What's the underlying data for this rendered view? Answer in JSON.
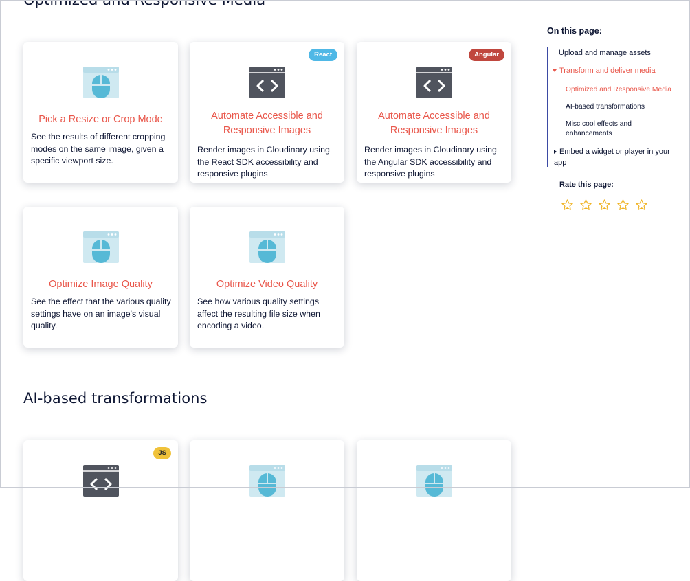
{
  "sections": [
    {
      "title": "Optimized and Responsive Media"
    },
    {
      "title": "AI-based transformations"
    }
  ],
  "cards": [
    {
      "title": "Pick a Resize or Crop Mode",
      "description": "See the results of different cropping modes on the same image, given a specific viewport size.",
      "icon": "mouse-window-icon",
      "badge": ""
    },
    {
      "title": "Automate Accessible and Responsive Images",
      "description": "Render images in Cloudinary using the React SDK accessibility and responsive plugins",
      "icon": "code-window-icon",
      "badge": "React"
    },
    {
      "title": "Automate Accessible and Responsive Images",
      "description": "Render images in Cloudinary using the Angular SDK accessibility and responsive plugins",
      "icon": "code-window-icon",
      "badge": "Angular"
    },
    {
      "title": "Optimize Image Quality",
      "description": "See the effect that the various quality settings have on an image's visual quality.",
      "icon": "mouse-window-icon",
      "badge": ""
    },
    {
      "title": "Optimize Video Quality",
      "description": "See how various quality settings affect the resulting file size when encoding a video.",
      "icon": "mouse-window-icon",
      "badge": ""
    },
    {
      "title": "",
      "description": "",
      "icon": "code-window-icon",
      "badge": "JS"
    },
    {
      "title": "",
      "description": "",
      "icon": "mouse-window-icon",
      "badge": ""
    },
    {
      "title": "",
      "description": "",
      "icon": "mouse-window-icon",
      "badge": ""
    }
  ],
  "toc": {
    "heading": "On this page:",
    "items": [
      {
        "label": "Upload and manage assets"
      },
      {
        "label": "Transform and deliver media"
      },
      {
        "label": "Optimized and Responsive Media"
      },
      {
        "label": "AI-based transformations"
      },
      {
        "label": "Misc cool effects and enhancements"
      },
      {
        "label": "Embed a widget or player in your app"
      }
    ]
  },
  "rating": {
    "label": "Rate this page:",
    "max": 5,
    "value": 0
  },
  "colors": {
    "accent": "#e9574b",
    "text": "#0e1633",
    "toc_bar": "#3b4aa3",
    "icon_light": "#cfe9f1",
    "icon_blue": "#56b9d6",
    "icon_dark": "#50545e",
    "star": "#f0b323",
    "badge_react": "#4fb8e6",
    "badge_angular": "#c0473e",
    "badge_js": "#f0c23a"
  }
}
